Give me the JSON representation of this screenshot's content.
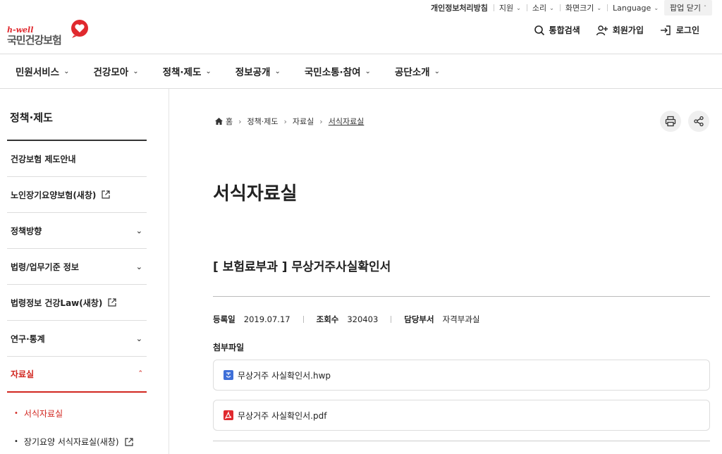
{
  "util": {
    "privacy": "개인정보처리방침",
    "support": "지원",
    "sound": "소리",
    "screen": "화면크기",
    "language": "Language",
    "close_popup": "팝업 닫기"
  },
  "logo": {
    "tagline": "h-well",
    "name": "국민건강보험"
  },
  "header": {
    "search": "통합검색",
    "join": "회원가입",
    "login": "로그인"
  },
  "gnb": [
    "민원서비스",
    "건강모아",
    "정책·제도",
    "정보공개",
    "국민소통·참여",
    "공단소개"
  ],
  "lnb": {
    "title": "정책·제도",
    "items": [
      {
        "label": "건강보험 제도안내"
      },
      {
        "label": "노인장기요양보험(새창)"
      },
      {
        "label": "정책방향"
      },
      {
        "label": "법령/업무기준 정보"
      },
      {
        "label": "법령정보 건강Law(새창)"
      },
      {
        "label": "연구·통계"
      },
      {
        "label": "자료실"
      }
    ],
    "subitems": [
      {
        "label": "서식자료실"
      },
      {
        "label": "장기요양 서식자료실(새창)"
      }
    ]
  },
  "breadcrumb": {
    "home": "홈",
    "b1": "정책·제도",
    "b2": "자료실",
    "b3": "서식자료실"
  },
  "main": {
    "page_title": "서식자료실",
    "doc_title": "[ 보험료부과 ] 무상거주사실확인서",
    "reg_label": "등록일",
    "reg_value": "2019.07.17",
    "views_label": "조회수",
    "views_value": "320403",
    "dept_label": "담당부서",
    "dept_value": "자격부과실",
    "attach_label": "첨부파일",
    "files": [
      {
        "name": "무상거주 사실확인서.hwp"
      },
      {
        "name": "무상거주 사실확인서.pdf"
      }
    ]
  },
  "colors": {
    "accent": "#d1261f",
    "hwp": "#3e6fd8",
    "pdf": "#e0292e"
  }
}
